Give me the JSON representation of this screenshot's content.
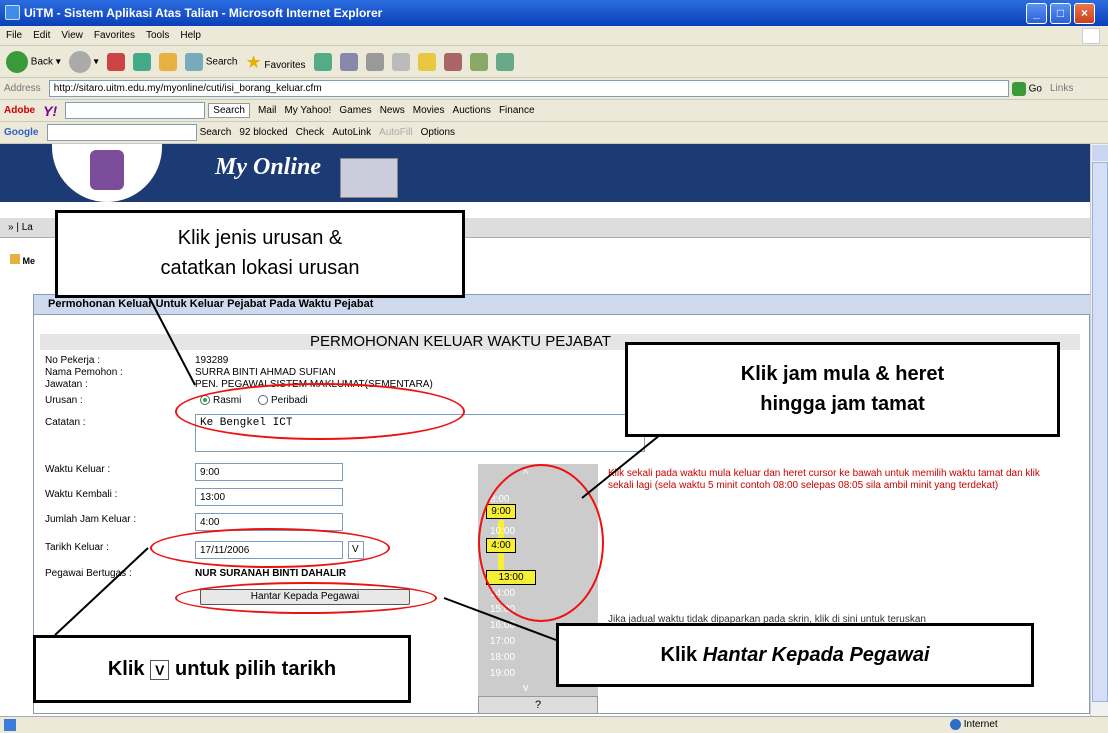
{
  "window": {
    "title": "UiTM - Sistem Aplikasi Atas Talian - Microsoft Internet Explorer",
    "accent": "#0a3fb8"
  },
  "menu": [
    "File",
    "Edit",
    "View",
    "Favorites",
    "Tools",
    "Help"
  ],
  "toolbar": {
    "back": "Back",
    "search": "Search",
    "favorites": "Favorites"
  },
  "address": {
    "label": "Address",
    "url": "http://sitaro.uitm.edu.my/myonline/cuti/isi_borang_keluar.cfm",
    "go": "Go",
    "links": "Links"
  },
  "linkbar": {
    "adobe": "Adobe",
    "search": "Search",
    "items": [
      "Mail",
      "My Yahoo!",
      "Games",
      "News",
      "Movies",
      "Auctions",
      "Finance"
    ]
  },
  "googlebar": {
    "brand": "Google",
    "search": "Search",
    "blocked": "92 blocked",
    "check": "Check",
    "autolink": "AutoLink",
    "autofill": "AutoFill",
    "options": "Options"
  },
  "page": {
    "brand": "My Online",
    "nav_prefix": "» | La",
    "tree_label": "Me",
    "panel_title": "Permohonan Keluar Untuk Keluar Pejabat Pada Waktu Pejabat",
    "form_title": "PERMOHONAN KELUAR WAKTU PEJABAT",
    "labels": {
      "no_pekerja": "No Pekerja :",
      "nama": "Nama Pemohon :",
      "jawatan": "Jawatan :",
      "urusan": "Urusan :",
      "catatan": "Catatan :",
      "keluar": "Waktu Keluar :",
      "kembali": "Waktu Kembali :",
      "jumlah": "Jumlah Jam Keluar :",
      "tarikh": "Tarikh Keluar :",
      "pegawai": "Pegawai Bertugas :"
    },
    "values": {
      "no_pekerja": "193289",
      "nama": "SURRA BINTI AHMAD SUFIAN",
      "jawatan": "PEN. PEGAWAI SISTEM MAKLUMAT(SEMENTARA)",
      "rasmi": "Rasmi",
      "peribadi": "Peribadi",
      "catatan": "Ke Bengkel ICT",
      "keluar": "9:00",
      "kembali": "13:00",
      "jumlah": "4:00",
      "tarikh": "17/11/2006",
      "date_btn": "V",
      "pegawai": "NUR SURANAH BINTI DAHALIR",
      "submit": "Hantar Kepada Pegawai"
    },
    "instructions": "Klik sekali pada waktu mula keluar dan heret cursor ke bawah untuk memilih waktu tamat dan klik sekali lagi (sela waktu 5 minit contoh 08:00 selepas 08:05 sila ambil minit yang terdekat)",
    "note": "Jika jadual waktu tidak dipaparkan pada skrin, klik di sini untuk teruskan",
    "timeline": {
      "arrow_up": "^",
      "arrow_down": "v",
      "marks": [
        "8:00",
        "9:00",
        "10:00",
        "4:00",
        "13:00",
        "14:00",
        "15:00",
        "16:00",
        "17:00",
        "18:00",
        "19:00"
      ],
      "help": "?"
    }
  },
  "callouts": {
    "c1_line1": "Klik jenis urusan &",
    "c1_line2": "catatkan lokasi urusan",
    "c2_line1": "Klik jam mula & heret",
    "c2_line2": "hingga jam tamat",
    "c3_prefix": "Klik",
    "c3_btn": "V",
    "c3_suffix": "untuk pilih tarikh",
    "c4_prefix": "Klik",
    "c4_italic": "Hantar Kepada Pegawai"
  },
  "status": {
    "zone": "Internet"
  }
}
